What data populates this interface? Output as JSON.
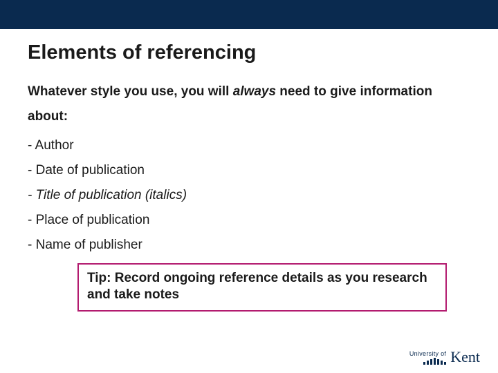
{
  "title": "Elements of referencing",
  "intro": {
    "pre": "Whatever style you use, you will ",
    "emph": "always",
    "post": " need to give information about:"
  },
  "items": [
    {
      "text": "- Author",
      "italic": false
    },
    {
      "text": "- Date of publication",
      "italic": false
    },
    {
      "text": "- Title of publication (italics)",
      "italic": true
    },
    {
      "text": "- Place of publication",
      "italic": false
    },
    {
      "text": "- Name of publisher",
      "italic": false
    }
  ],
  "tip": "Tip: Record ongoing reference details as you research and take notes",
  "logo": {
    "uni": "University of",
    "kent": "Kent"
  }
}
